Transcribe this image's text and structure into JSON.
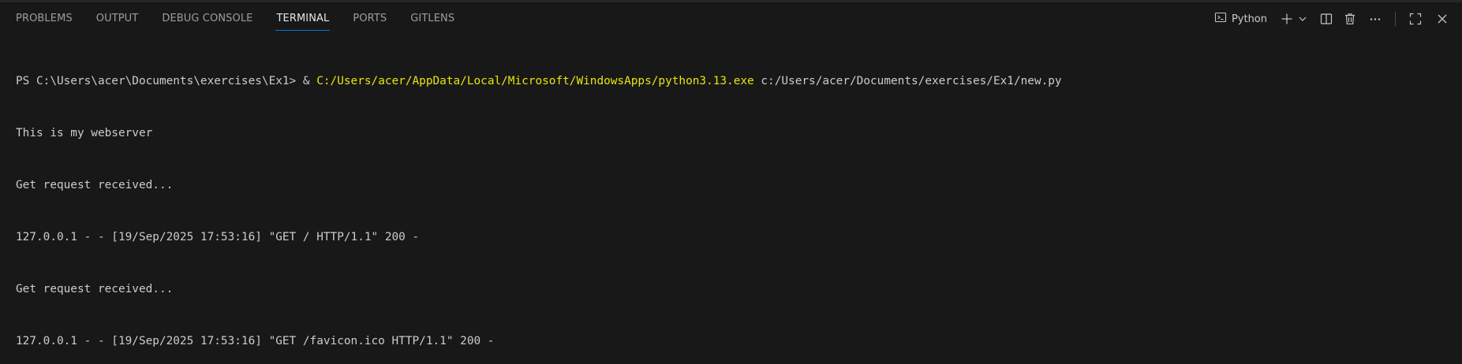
{
  "panel": {
    "tabs": [
      {
        "label": "PROBLEMS"
      },
      {
        "label": "OUTPUT"
      },
      {
        "label": "DEBUG CONSOLE"
      },
      {
        "label": "TERMINAL"
      },
      {
        "label": "PORTS"
      },
      {
        "label": "GITLENS"
      }
    ],
    "active_tab": "TERMINAL",
    "terminal_profile": "Python",
    "accent_color": "#0078d4",
    "icons": [
      "terminal-icon",
      "plus-icon",
      "chevron-down-icon",
      "split-icon",
      "trash-icon",
      "more-icon",
      "maximize-icon",
      "close-icon"
    ]
  },
  "terminal": {
    "prompt": "PS C:\\Users\\acer\\Documents\\exercises\\Ex1> ",
    "command_operator": "& ",
    "command_exe": "C:/Users/acer/AppData/Local/Microsoft/WindowsApps/python3.13.exe",
    "command_args": " c:/Users/acer/Documents/exercises/Ex1/new.py",
    "output_lines": [
      "This is my webserver",
      "Get request received...",
      "127.0.0.1 - - [19/Sep/2025 17:53:16] \"GET / HTTP/1.1\" 200 -",
      "Get request received...",
      "127.0.0.1 - - [19/Sep/2025 17:53:16] \"GET /favicon.ico HTTP/1.1\" 200 -"
    ],
    "colors": {
      "background": "#181818",
      "text": "#cccccc",
      "exe_path": "#e5e510"
    }
  }
}
